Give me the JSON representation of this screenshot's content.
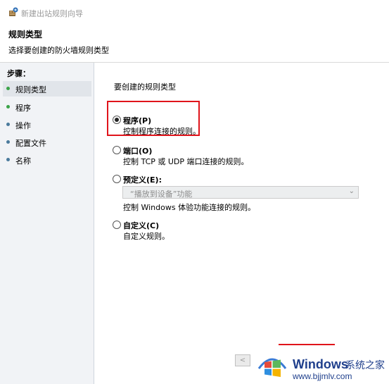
{
  "window": {
    "title": "新建出站规则向导"
  },
  "header": {
    "title": "规则类型",
    "subtitle": "选择要创建的防火墙规则类型"
  },
  "sidebar": {
    "heading": "步骤：",
    "items": [
      {
        "label": "规则类型",
        "active": true
      },
      {
        "label": "程序"
      },
      {
        "label": "操作"
      },
      {
        "label": "配置文件"
      },
      {
        "label": "名称"
      }
    ]
  },
  "main": {
    "prompt": "要创建的规则类型",
    "options": [
      {
        "label": "程序(P)",
        "desc": "控制程序连接的规则。",
        "checked": true
      },
      {
        "label": "端口(O)",
        "desc": "控制 TCP 或 UDP 端口连接的规则。"
      },
      {
        "label": "预定义(E):",
        "desc": "控制 Windows 体验功能连接的规则。"
      },
      {
        "label": "自定义(C)",
        "desc": "自定义规则。"
      }
    ],
    "predefined_dropdown": {
      "value": "“播放到设备”功能"
    }
  },
  "footer": {
    "back_label": "<"
  },
  "watermark": {
    "brand": "Windows",
    "brand_cn": "系统之家",
    "url": "www.bjjmlv.com"
  },
  "colors": {
    "highlight": "#e0141b",
    "sidebar_bg": "#f1f3f6",
    "step_dot_current": "#3aa348",
    "step_dot": "#4a7a9c"
  }
}
